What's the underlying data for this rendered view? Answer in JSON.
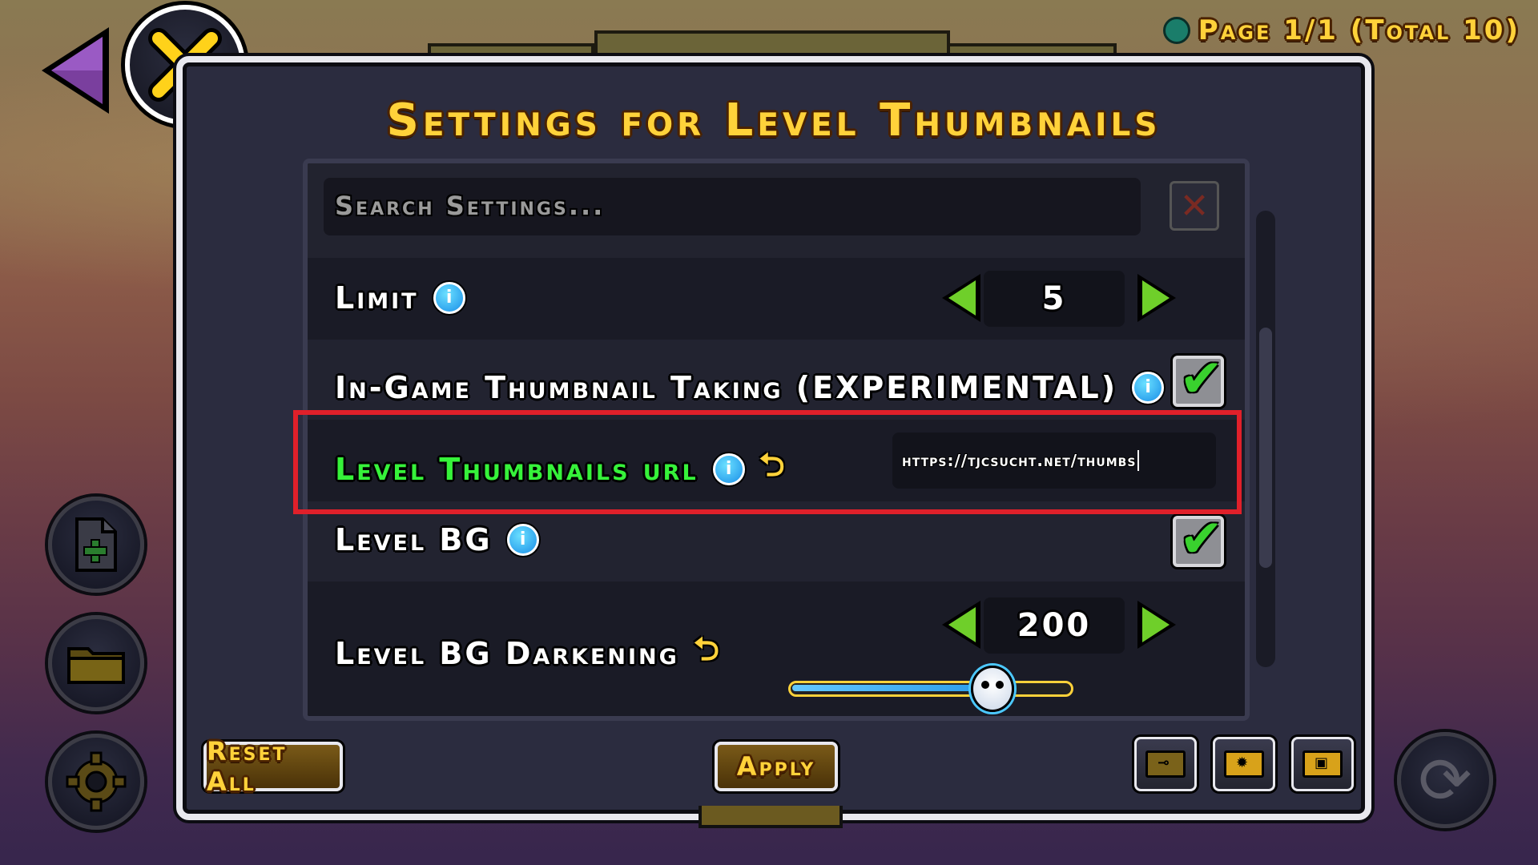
{
  "page_indicator": "Page 1/1 (Total 10)",
  "dialog": {
    "title": "Settings for Level Thumbnails",
    "search_placeholder": "Search Settings...",
    "settings": [
      {
        "label": "Limit",
        "value": "5"
      },
      {
        "label": "In-Game Thumbnail Taking (EXPERIMENTAL)",
        "checked": true
      },
      {
        "label": "Level Thumbnails url",
        "value": "https://tjcsucht.net/thumbs"
      },
      {
        "label": "Level BG",
        "checked": true
      },
      {
        "label": "Level BG Darkening",
        "value": "200",
        "fill": 0.72
      }
    ],
    "reset_all_label": "Reset All",
    "apply_label": "Apply"
  },
  "colors": {
    "highlight": "#e0202a",
    "accent": "#ffd23a",
    "active_label": "#36f23a"
  },
  "icons": [
    "back-arrow-icon",
    "close-icon",
    "info-icon",
    "reset-icon",
    "checkmark-icon",
    "new-file-icon",
    "folder-icon",
    "gear-icon",
    "rotate-icon"
  ]
}
